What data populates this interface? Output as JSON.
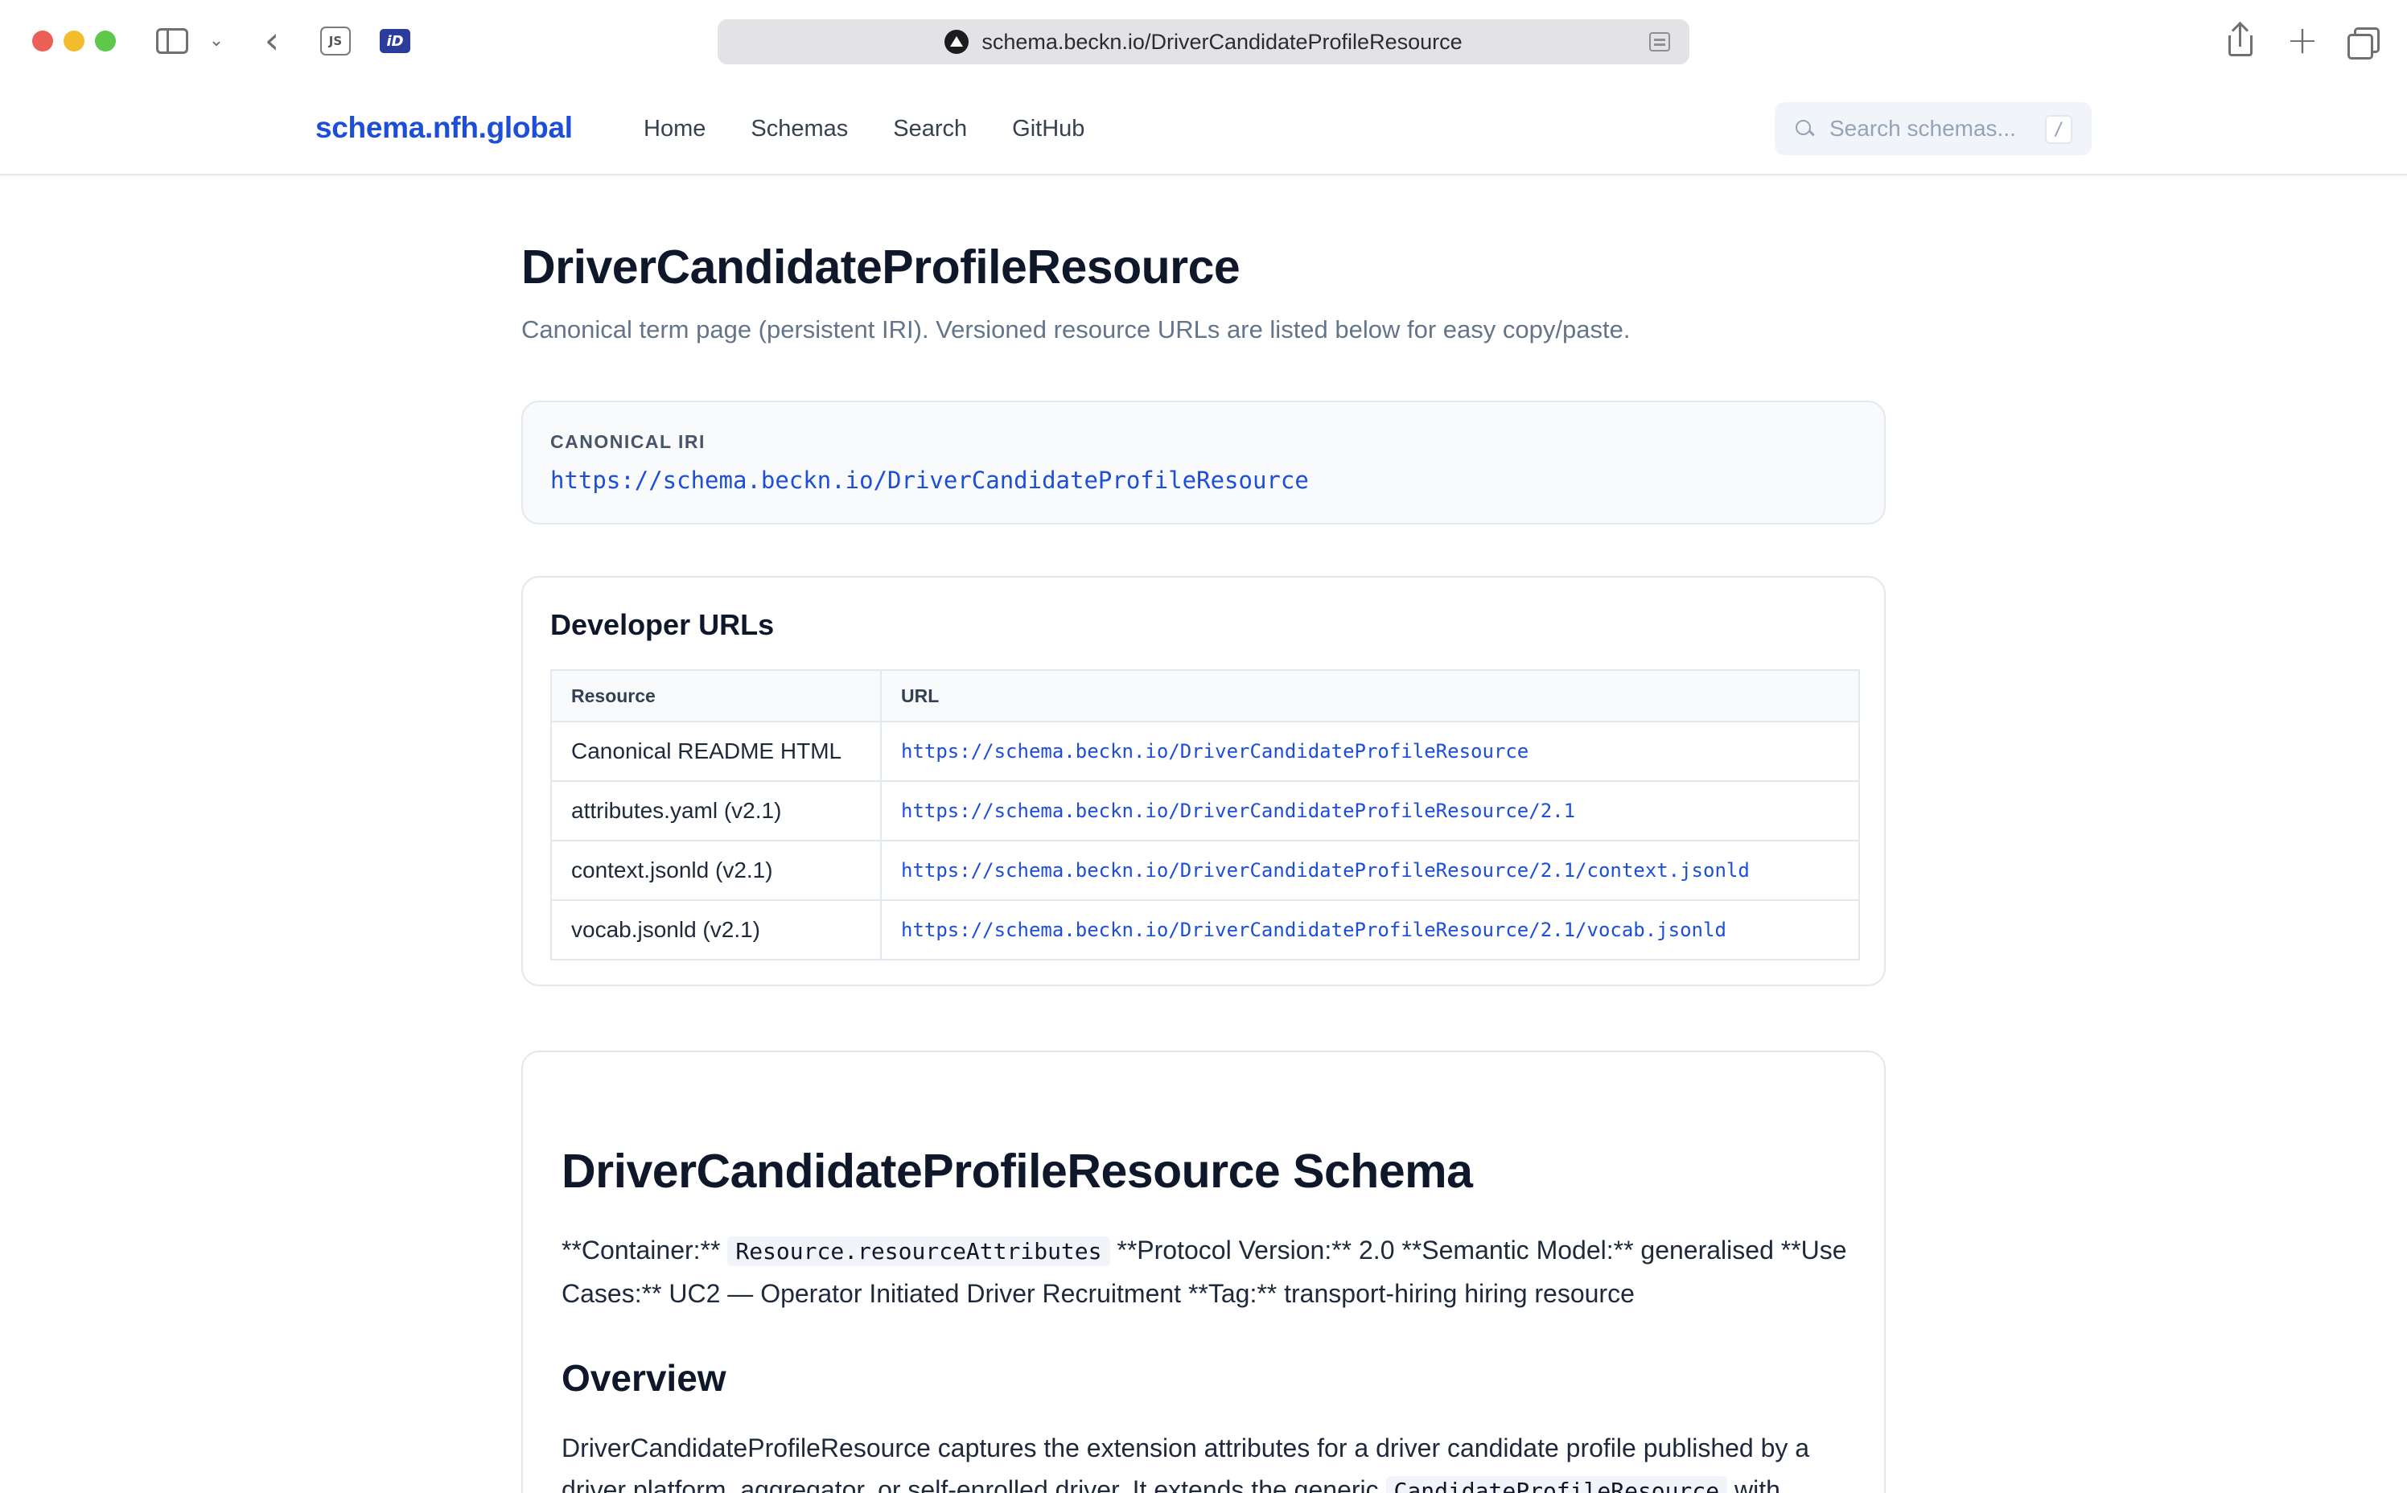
{
  "browser": {
    "url": "schema.beckn.io/DriverCandidateProfileResource",
    "ext_js_label": "JS",
    "ext_id_label": "iD"
  },
  "header": {
    "brand": "schema.nfh.global",
    "nav": [
      "Home",
      "Schemas",
      "Search",
      "GitHub"
    ],
    "search_placeholder": "Search schemas...",
    "search_shortcut": "/"
  },
  "page": {
    "title": "DriverCandidateProfileResource",
    "subtitle": "Canonical term page (persistent IRI). Versioned resource URLs are listed below for easy copy/paste."
  },
  "canonical": {
    "label": "CANONICAL IRI",
    "iri": "https://schema.beckn.io/DriverCandidateProfileResource"
  },
  "developer_urls": {
    "heading": "Developer URLs",
    "columns": [
      "Resource",
      "URL"
    ],
    "rows": [
      {
        "resource": "Canonical README HTML",
        "url": "https://schema.beckn.io/DriverCandidateProfileResource"
      },
      {
        "resource": "attributes.yaml (v2.1)",
        "url": "https://schema.beckn.io/DriverCandidateProfileResource/2.1"
      },
      {
        "resource": "context.jsonld (v2.1)",
        "url": "https://schema.beckn.io/DriverCandidateProfileResource/2.1/context.jsonld"
      },
      {
        "resource": "vocab.jsonld (v2.1)",
        "url": "https://schema.beckn.io/DriverCandidateProfileResource/2.1/vocab.jsonld"
      }
    ]
  },
  "readme": {
    "title": "DriverCandidateProfileResource Schema",
    "meta_prefix": "**Container:**",
    "meta_code": "Resource.resourceAttributes",
    "meta_suffix": "**Protocol Version:** 2.0 **Semantic Model:** generalised **Use Cases:** UC2 — Operator Initiated Driver Recruitment **Tag:** transport-hiring hiring resource",
    "overview_heading": "Overview",
    "overview_text": "DriverCandidateProfileResource captures the extension attributes for a driver candidate profile published by a driver platform, aggregator, or self-enrolled driver. It extends the generic",
    "overview_code": "CandidateProfileResource",
    "overview_tail": "with"
  },
  "colors": {
    "brand": "#1d4ed8",
    "link": "#1d4ed8",
    "text": "#0f172a",
    "muted": "#64748b",
    "border": "#e2e8f0"
  }
}
